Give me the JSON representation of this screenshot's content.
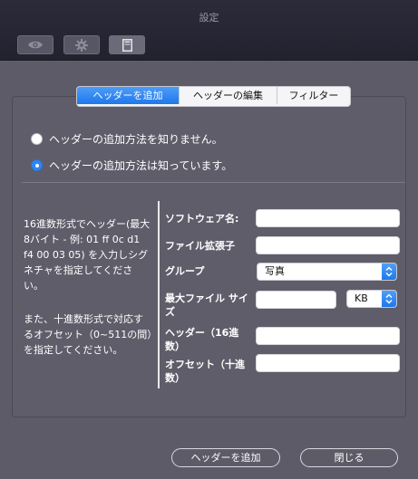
{
  "window": {
    "title": "設定"
  },
  "toolbar": {
    "items": [
      {
        "name": "eye-icon"
      },
      {
        "name": "gear-icon"
      },
      {
        "name": "document-icon"
      }
    ]
  },
  "tabs": [
    {
      "label": "ヘッダーを追加",
      "active": true
    },
    {
      "label": "ヘッダーの編集",
      "active": false
    },
    {
      "label": "フィルター",
      "active": false
    }
  ],
  "options": {
    "unknown": "ヘッダーの追加方法を知りません。",
    "known": "ヘッダーの追加方法は知っています。",
    "selected": "known"
  },
  "description": {
    "p1": "16進数形式でヘッダー(最大8バイト - 例: 01 ff 0c d1 f4 00 03 05) を入力しシグネチャを指定してください。",
    "p2": "また、十進数形式で対応するオフセット（0~511の間）を指定してください。"
  },
  "form": {
    "software_label": "ソフトウェア名:",
    "software_value": "",
    "extension_label": "ファイル拡張子",
    "extension_value": "",
    "group_label": "グループ",
    "group_value": "写真",
    "maxsize_label": "最大ファイル サイズ",
    "maxsize_value": "",
    "unit_value": "KB",
    "header_label": "ヘッダー（16進数）",
    "header_value": "",
    "offset_label": "オフセット（十進数）",
    "offset_value": ""
  },
  "buttons": {
    "add": "ヘッダーを追加",
    "close": "閉じる"
  },
  "colors": {
    "accent": "#1f78ec",
    "background": "#5d5b68",
    "titlebar": "#262634"
  }
}
